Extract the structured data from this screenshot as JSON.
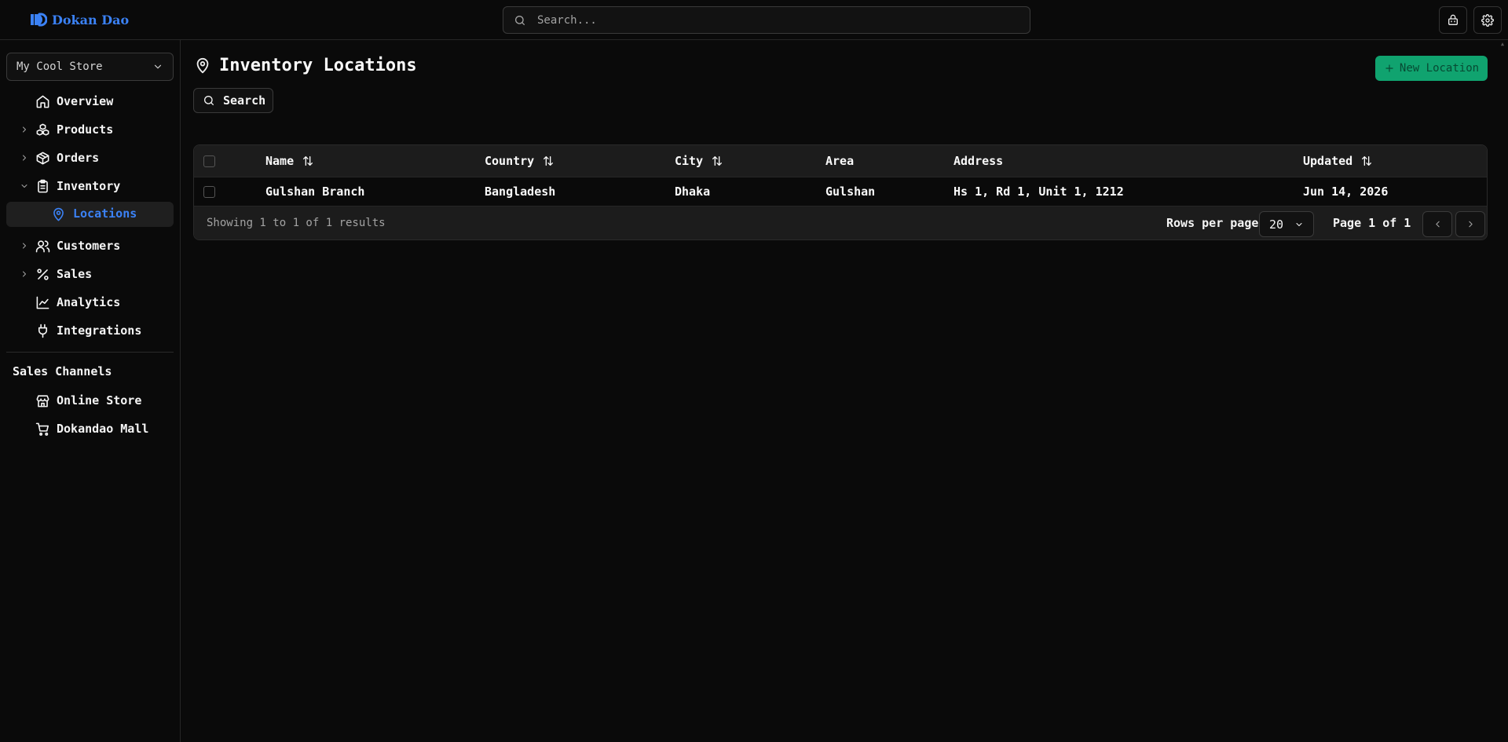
{
  "app": {
    "brand": "Dokan Dao",
    "accent_color": "#3b82f6",
    "success_color": "#10a36f"
  },
  "topbar": {
    "search_placeholder": "Search...",
    "store_icon": "store-bag-icon",
    "settings_icon": "gear-icon"
  },
  "sidebar": {
    "store_selector": "My Cool Store",
    "nav": [
      {
        "label": "Overview",
        "icon": "home-icon"
      },
      {
        "label": "Products",
        "icon": "boxes-icon"
      },
      {
        "label": "Orders",
        "icon": "package-icon"
      },
      {
        "label": "Inventory",
        "icon": "clipboard-icon"
      },
      {
        "label": "Customers",
        "icon": "users-icon"
      },
      {
        "label": "Sales",
        "icon": "percent-icon"
      },
      {
        "label": "Analytics",
        "icon": "line-chart-icon"
      },
      {
        "label": "Integrations",
        "icon": "plug-icon"
      }
    ],
    "inventory_sub": {
      "label": "Locations",
      "icon": "map-pin-icon"
    },
    "channels_title": "Sales Channels",
    "channels": [
      {
        "label": "Online Store",
        "icon": "storefront-icon"
      },
      {
        "label": "Dokandao Mall",
        "icon": "cart-icon"
      }
    ]
  },
  "main": {
    "title": "Inventory Locations",
    "new_button": "New Location",
    "search_button": "Search",
    "table": {
      "columns": [
        "Name",
        "Country",
        "City",
        "Area",
        "Address",
        "Updated"
      ],
      "rows": [
        {
          "name": "Gulshan Branch",
          "country": "Bangladesh",
          "city": "Dhaka",
          "area": "Gulshan",
          "address": "Hs 1, Rd 1, Unit 1, 1212",
          "updated": "Jun 14, 2026"
        }
      ]
    },
    "footer": {
      "showing": "Showing 1 to 1 of 1 results",
      "rows_per_page_label": "Rows per page",
      "rows_per_page_value": "20",
      "page_info": "Page 1 of 1"
    }
  }
}
